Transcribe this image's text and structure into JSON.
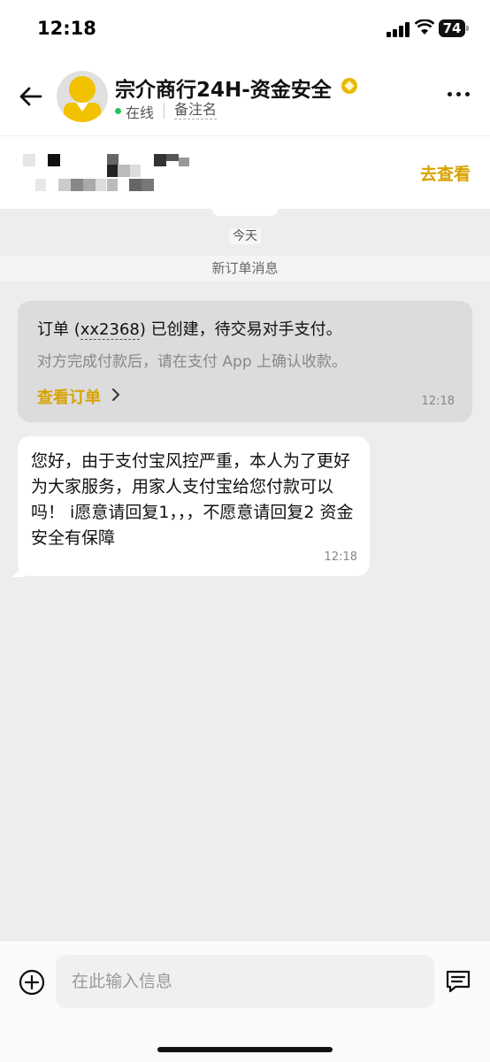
{
  "status_bar": {
    "time": "12:18",
    "battery": "74"
  },
  "header": {
    "contact_name": "宗介商行24H-资金安全",
    "status": "在线",
    "remark": "备注名"
  },
  "banner": {
    "link_label": "去查看"
  },
  "chat": {
    "date_label": "今天",
    "system_notice": "新订单消息",
    "order_card": {
      "title_prefix": "订单 (",
      "order_id": "xx2368",
      "title_suffix": ") 已创建，待交易对手支付。",
      "description": "对方完成付款后，请在支付 App 上确认收款。",
      "action_label": "查看订单",
      "time": "12:18"
    },
    "messages": [
      {
        "text": "您好，由于支付宝风控严重，本人为了更好为大家服务，用家人支付宝给您付款可以吗！ i愿意请回复1，，，不愿意请回复2 资金安全有保障",
        "time": "12:18"
      }
    ]
  },
  "input": {
    "placeholder": "在此输入信息"
  },
  "colors": {
    "accent": "#d9a200",
    "online": "#2bbf5b",
    "background": "#ededed"
  }
}
